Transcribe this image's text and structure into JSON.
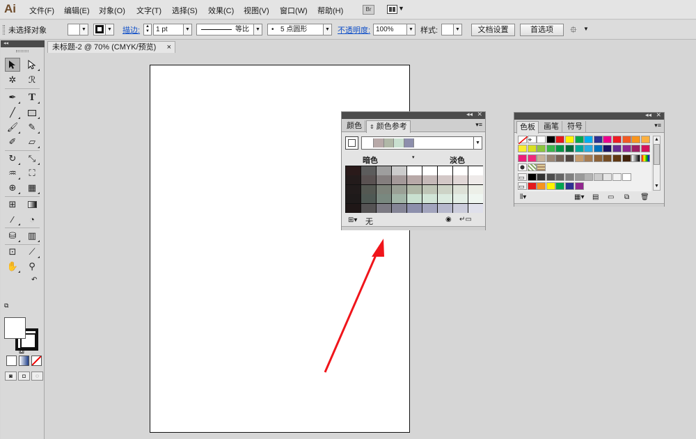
{
  "app": {
    "logo": "Ai"
  },
  "menu": [
    "文件(F)",
    "编辑(E)",
    "对象(O)",
    "文字(T)",
    "选择(S)",
    "效果(C)",
    "视图(V)",
    "窗口(W)",
    "帮助(H)"
  ],
  "bridge_label": "Br",
  "control": {
    "selection_status": "未选择对象",
    "stroke_label": "描边:",
    "stroke_weight": "1 pt",
    "profile_label": "等比",
    "brush_label": "5 点圆形",
    "opacity_label": "不透明度:",
    "opacity_value": "100%",
    "style_label": "样式:",
    "doc_setup": "文档设置",
    "preferences": "首选项"
  },
  "document_tab": {
    "title": "未标题-2 @ 70% (CMYK/预览)",
    "close": "×"
  },
  "color_guide": {
    "tabs": [
      "颜色",
      "颜色参考"
    ],
    "shade_label": "暗色",
    "tint_label": "淡色",
    "none_label": "无",
    "harmony_colors": [
      "#ffffff",
      "#b8a9a8",
      "#b0b8a7",
      "#c9e0d0",
      "#8d8fac"
    ],
    "grid": [
      [
        "#2a1a1a",
        "#5c5c5c",
        "#9e9e9e",
        "#cccccc",
        "#ffffff",
        "#ffffff",
        "#ffffff",
        "#ffffff",
        "#ffffff"
      ],
      [
        "#231b1b",
        "#5a5252",
        "#847e7e",
        "#a49999",
        "#b8a9a8",
        "#c5b9b8",
        "#d3c8c7",
        "#e0d7d6",
        "#eeeae9"
      ],
      [
        "#211b1b",
        "#545852",
        "#7d837a",
        "#9aa095",
        "#b0b8a7",
        "#bec5b6",
        "#cdd3c6",
        "#dde1d7",
        "#ecefe8"
      ],
      [
        "#1e1a1a",
        "#4f5954",
        "#79887f",
        "#a2b6a8",
        "#c9e0d0",
        "#d1e5d7",
        "#dbeadf",
        "#e4efe7",
        "#eff6f1"
      ],
      [
        "#1f1717",
        "#555354",
        "#7c7a83",
        "#858596",
        "#8d8fac",
        "#a2a4bd",
        "#b6b8cc",
        "#cbccdb",
        "#dfe0eb"
      ]
    ]
  },
  "swatches": {
    "tabs": [
      "色板",
      "画笔",
      "符号"
    ],
    "rows": [
      [
        "none",
        "register",
        "#ffffff",
        "#000000",
        "#e4191c",
        "#fff200",
        "#00a651",
        "#00aeef",
        "#2e3192",
        "#ec008c",
        "#ed1c24",
        "#f15a24",
        "#f7941d",
        "#fbb040"
      ],
      [
        "#f9ed32",
        "#d7df23",
        "#8dc63f",
        "#39b54a",
        "#009444",
        "#006838",
        "#00a79d",
        "#29abe2",
        "#0071bc",
        "#1b1464",
        "#662d91",
        "#92278f",
        "#9e1f63",
        "#d4145a"
      ],
      [
        "#ed1e79",
        "#ee2a7b",
        "#c7b299",
        "#998675",
        "#736357",
        "#534741",
        "#c69c6d",
        "#a67c52",
        "#8c6239",
        "#754c24",
        "#603813",
        "#42210b",
        "gradient-bw",
        "gradient-rainbow"
      ],
      [
        "pattern-1",
        "pattern-2",
        "pattern-3"
      ],
      [
        "folder",
        "#000000",
        "#333333",
        "#4d4d4d",
        "#666666",
        "#808080",
        "#999999",
        "#b3b3b3",
        "#cccccc",
        "#e6e6e6",
        "#f2f2f2",
        "#ffffff"
      ],
      [
        "folder",
        "#e4191c",
        "#f7941d",
        "#fff200",
        "#00a651",
        "#2e3192",
        "#92278f"
      ]
    ]
  }
}
